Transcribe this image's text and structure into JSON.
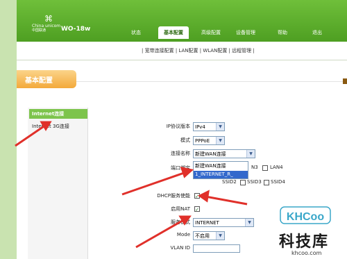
{
  "header": {
    "logo_text": "China unicom",
    "logo_subtext": "中国联通",
    "model": "WO-18w",
    "nav": [
      {
        "label": "状态"
      },
      {
        "label": "基本配置"
      },
      {
        "label": "高级配置"
      },
      {
        "label": "设备管理"
      },
      {
        "label": "帮助"
      },
      {
        "label": "退出"
      }
    ]
  },
  "subnav": {
    "items": [
      "宽带连接配置",
      "LAN配置",
      "WLAN配置",
      "远程管理"
    ]
  },
  "section": {
    "title": "基本配置"
  },
  "sidebar": {
    "items": [
      {
        "label": "Internet连接"
      },
      {
        "label": "Internet 3G连接"
      }
    ]
  },
  "form": {
    "ip_version": {
      "label": "IP协议版本",
      "value": "IPv4"
    },
    "mode": {
      "label": "模式",
      "value": "PPPoE"
    },
    "conn_name": {
      "label": "连接名称",
      "value": "新建WAN连接"
    },
    "port_bind": {
      "label": "端口绑定",
      "lan3": "N3",
      "lan4": "LAN4",
      "ssid2": "SSID2",
      "ssid3": "SSID3",
      "ssid4": "SSID4"
    },
    "dhcp": {
      "label": "DHCP服务使能"
    },
    "nat": {
      "label": "启用NAT"
    },
    "service": {
      "label": "服务模式",
      "value": "INTERNET"
    },
    "vlan_mode": {
      "label": "Mode",
      "value": "不启用"
    },
    "vlan_id": {
      "label": "VLAN ID"
    }
  },
  "dropdown": {
    "options": [
      "新建WAN连接",
      "1_INTERNET_R_"
    ]
  },
  "watermark": {
    "logo": "KHCoo",
    "text": "科技库",
    "url": "khcoo.com"
  },
  "colors": {
    "header_green": "#4e9f22",
    "banner_orange": "#f3a93a",
    "arrow_red": "#e0302a",
    "selected_blue": "#3369cc"
  }
}
